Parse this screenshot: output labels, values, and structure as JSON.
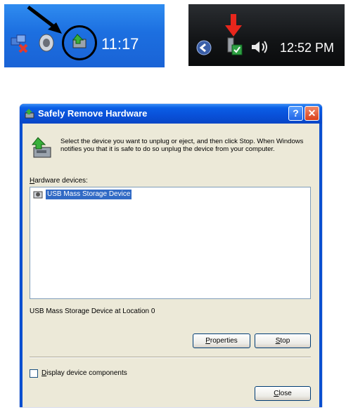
{
  "tray_xp": {
    "clock": "11:17",
    "icons": [
      "network-error-icon",
      "speaker-icon",
      "safely-remove-hardware-icon"
    ],
    "annotation": "black-arrow-and-circle"
  },
  "tray_vista": {
    "clock": "12:52 PM",
    "icons": [
      "show-hidden-icon",
      "safely-remove-hardware-icon",
      "volume-icon"
    ],
    "annotation": "red-arrow"
  },
  "dialog": {
    "title": "Safely Remove Hardware",
    "help_button": "?",
    "close_button": "✕",
    "instructions": "Select the device you want to unplug or eject, and then click Stop. When Windows notifies you that it is safe to do so unplug the device from your computer.",
    "hardware_label_prefix": "H",
    "hardware_label_rest": "ardware devices:",
    "devices": [
      {
        "name": "USB Mass Storage Device",
        "selected": true
      }
    ],
    "location_text": "USB Mass Storage Device at Location 0",
    "properties_button_prefix": "P",
    "properties_button_rest": "roperties",
    "stop_button_prefix": "S",
    "stop_button_rest": "top",
    "display_components_prefix": "D",
    "display_components_rest": "isplay device components",
    "display_components_checked": false,
    "close_button_prefix": "C",
    "close_button_rest": "lose"
  },
  "colors": {
    "xp_taskbar": "#1c6fe0",
    "vista_taskbar": "#121416",
    "titlebar": "#0a5ee6",
    "dialog_face": "#ece9d8",
    "selection": "#316ac5",
    "annotation_red": "#e8261c"
  }
}
